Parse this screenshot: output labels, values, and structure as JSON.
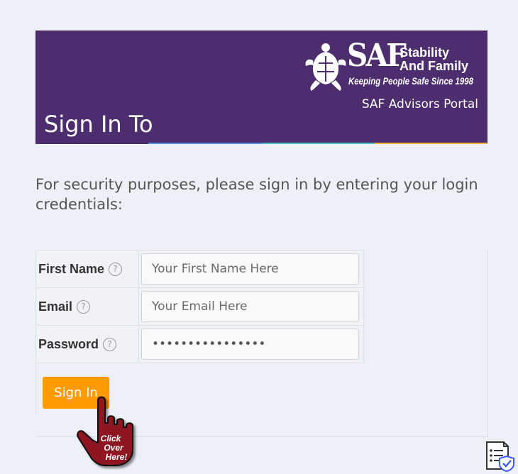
{
  "header": {
    "logo": {
      "brand": "SAF",
      "name_line1": "Stability",
      "name_line2": "And Family",
      "tagline": "Keeping People Safe Since 1998"
    },
    "portal_name": "SAF Advisors Portal",
    "title": "Sign In To"
  },
  "intro_text": "For security purposes, please sign in by entering your login credentials:",
  "form": {
    "fields": [
      {
        "label": "First Name",
        "help": "?",
        "placeholder": "Your First Name Here",
        "value": ""
      },
      {
        "label": "Email",
        "help": "?",
        "placeholder": "Your Email Here",
        "value": ""
      },
      {
        "label": "Password",
        "help": "?",
        "placeholder": "",
        "value": "••••••••••••••••"
      }
    ],
    "submit_label": "Sign In"
  },
  "cursor_graphic": {
    "text": "Click Over Here!"
  },
  "colors": {
    "header_bg": "#4c2d6d",
    "accent_button": "#ff9a00",
    "page_bg": "#edf1f7",
    "stripe": [
      "#4c2d6d",
      "#5b8fd9",
      "#4dbfc3",
      "#f3b23c"
    ]
  },
  "icons": [
    "help-icon",
    "pointing-hand-icon",
    "privacy-badge-icon",
    "turtle-logo-icon"
  ]
}
